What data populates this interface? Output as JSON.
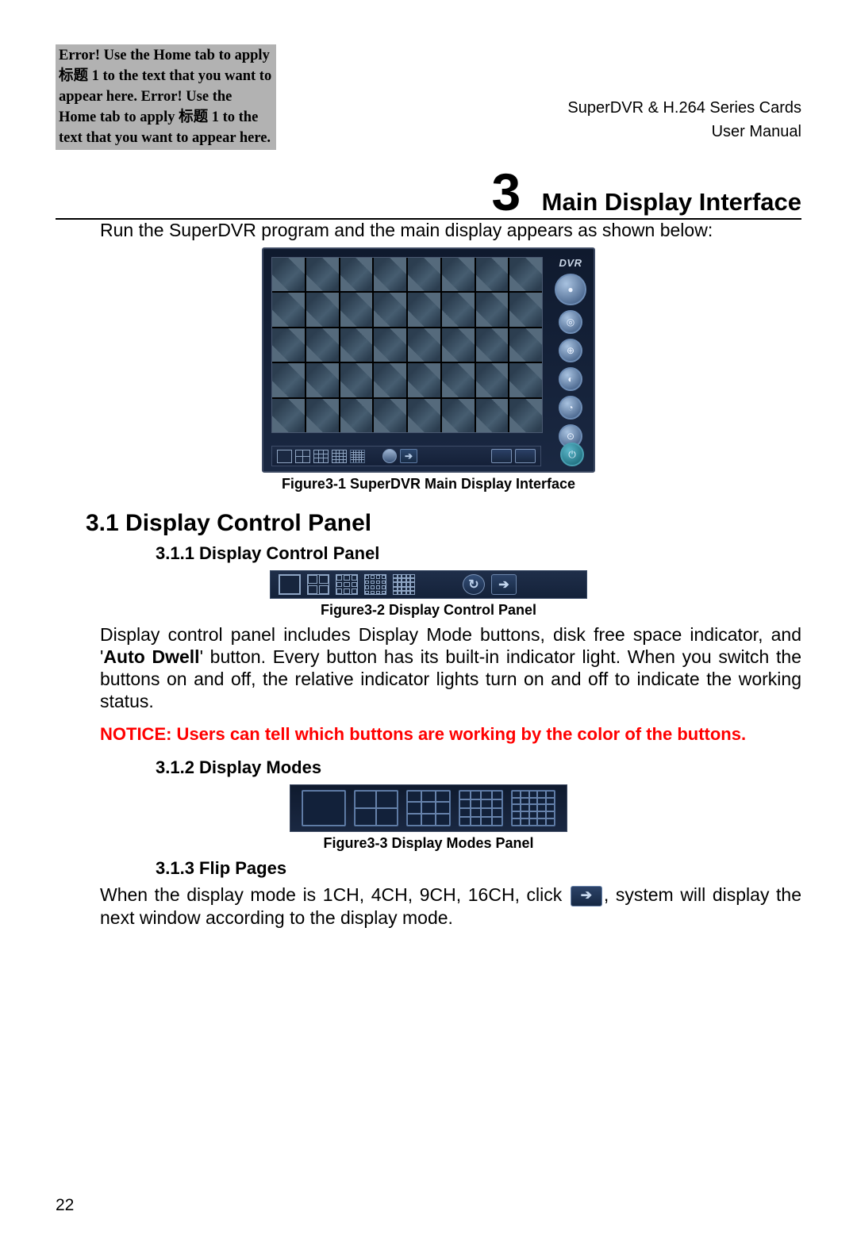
{
  "header": {
    "error_text": "Error! Use the Home tab to apply 标题 1 to the text that you want to appear here. Error! Use the Home tab to apply 标题 1 to the text that you want to appear here.",
    "product_line": "SuperDVR & H.264 Series Cards",
    "doc_type": "User Manual"
  },
  "chapter": {
    "number": "3",
    "title": "Main Display Interface",
    "intro": "Run the SuperDVR program and the main display appears as shown below:"
  },
  "figures": {
    "fig31_caption": "Figure3-1  SuperDVR Main Display Interface",
    "fig31_logo": "DVR",
    "fig32_caption": "Figure3-2  Display Control Panel",
    "fig33_caption": "Figure3-3  Display Modes Panel"
  },
  "sections": {
    "s31_title": "3.1 Display Control Panel",
    "s311_title": "3.1.1  Display Control Panel",
    "s311_body_1": "Display control panel includes Display Mode buttons, disk free space indicator, and '",
    "s311_bold": "Auto Dwell",
    "s311_body_2": "' button. Every button has its built-in indicator light. When you switch the buttons on and off, the relative indicator lights turn on and off to indicate the working status.",
    "notice": "NOTICE: Users can tell which buttons are working by the color of the buttons.",
    "s312_title": "3.1.2  Display Modes",
    "s313_title": "3.1.3  Flip Pages",
    "s313_body_1": "When the display mode is 1CH, 4CH, 9CH, 16CH, click",
    "s313_body_2": ", system will display the next window according to the display mode."
  },
  "page_number": "22",
  "icons": {
    "autodwell_glyph": "↻",
    "next_glyph": "➔",
    "power_glyph": "⏻"
  }
}
